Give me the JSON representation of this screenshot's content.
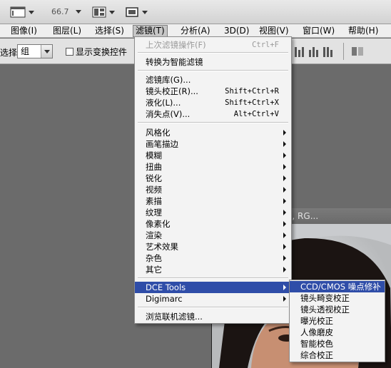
{
  "appbar": {
    "zoom": "66.7",
    "icons": [
      "document-frame-icon",
      "view-extras-icon",
      "arrange-documents-icon",
      "screen-mode-icon"
    ]
  },
  "menubar": {
    "items": [
      {
        "label": "图像(I)"
      },
      {
        "label": "图层(L)"
      },
      {
        "label": "选择(S)"
      },
      {
        "label": "滤镜(T)"
      },
      {
        "label": "分析(A)"
      },
      {
        "label": "3D(D)"
      },
      {
        "label": "视图(V)"
      },
      {
        "label": "窗口(W)"
      },
      {
        "label": "帮助(H)"
      }
    ]
  },
  "options": {
    "select_label": "选择:",
    "select_value": "组",
    "checkbox_label": "显示变换控件"
  },
  "document": {
    "title": "66.7% (背景 副本, RG..."
  },
  "filter_menu": {
    "last_filter": {
      "label": "上次滤镜操作(F)",
      "shortcut": "Ctrl+F"
    },
    "smart_filter": "转换为智能滤镜",
    "gallery": "滤镜库(G)...",
    "lens": {
      "label": "镜头校正(R)...",
      "shortcut": "Shift+Ctrl+R"
    },
    "liquify": {
      "label": "液化(L)...",
      "shortcut": "Shift+Ctrl+X"
    },
    "vanishing": {
      "label": "消失点(V)...",
      "shortcut": "Alt+Ctrl+V"
    },
    "groups": [
      "风格化",
      "画笔描边",
      "模糊",
      "扭曲",
      "锐化",
      "视频",
      "素描",
      "纹理",
      "像素化",
      "渲染",
      "艺术效果",
      "杂色",
      "其它"
    ],
    "plugins": [
      "DCE Tools",
      "Digimarc"
    ],
    "browse": "浏览联机滤镜..."
  },
  "submenu": {
    "items": [
      "CCD/CMOS 噪点修补",
      "镜头畸变校正",
      "镜头透视校正",
      "曝光校正",
      "人像磨皮",
      "智能校色",
      "综合校正"
    ]
  },
  "colors": {
    "menu_highlight": "#2f4da8",
    "menu_bg": "#f3f3f3",
    "workspace": "#6b6b6b"
  }
}
